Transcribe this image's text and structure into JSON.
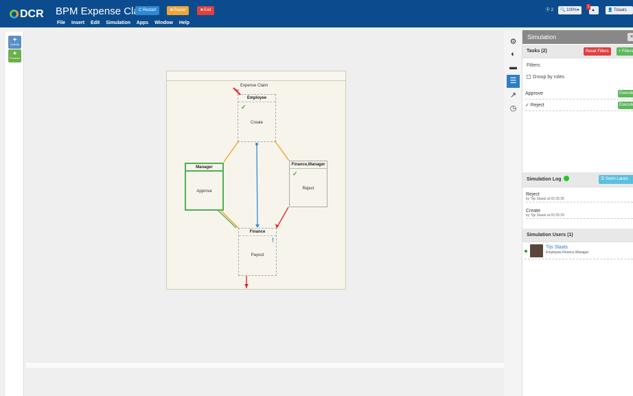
{
  "header": {
    "logo_text": "DCR",
    "app_title": "BPM Expense Claim",
    "restart_label": "C Restart",
    "pause_label": "■ Pause",
    "exit_label": "■ Exit",
    "menu": [
      "File",
      "Insert",
      "Edit",
      "Simulation",
      "Apps",
      "Window",
      "Help"
    ],
    "count_label": "ⓑ 2",
    "zoom_label": "🔍 100%▾",
    "notify_badge": "1",
    "notify_icon": "▲",
    "user_label": "👤 Tslaats"
  },
  "tools": {
    "activity_label": "Activity",
    "process_label": "Process"
  },
  "diagram": {
    "title": "Expense Claim",
    "activities": {
      "employee": {
        "role": "Employee",
        "label": "Create",
        "executed": "✓"
      },
      "manager": {
        "role": "Manager",
        "label": "Approve"
      },
      "finmgr": {
        "role": "Finance,Manager",
        "label": "Reject",
        "executed": "✓"
      },
      "finance": {
        "role": "Finance",
        "label": "Payout",
        "pending": "!"
      }
    }
  },
  "side_icons": [
    "gear-icon",
    "eye-slash-icon",
    "comment-icon",
    "list-icon",
    "share-icon",
    "clock-icon"
  ],
  "simulation": {
    "title": "Simulation",
    "close_label": "✕",
    "tasks_label": "Tasks (2)",
    "reset_filters_label": "Reset Filters",
    "filters_btn_label": "+ Filters",
    "filters_label": "Filters:",
    "group_by_roles_label": "Group by roles",
    "tasks": [
      {
        "name": "Approve",
        "button": "Execute"
      },
      {
        "name": "✓ Reject",
        "button": "Execute"
      }
    ],
    "log_label": "Simulation Log",
    "swim_lanes_label": "☰ Swim Lanes",
    "log": [
      {
        "event": "Reject",
        "by": "by Tijs Slaats at 02:25:35"
      },
      {
        "event": "Create",
        "by": "by Tijs Slaats at 02:25:29"
      }
    ],
    "users_label": "Simulation Users (1)",
    "user": {
      "name": "Tijs Slaats",
      "roles": "Employee,Finance,Manager"
    }
  },
  "colors": {
    "topbar": "#0c4c8e",
    "condition": "#f0a020",
    "response": "#2d8ad2",
    "exclude": "#e02020",
    "include_executed": "#4caf50"
  }
}
